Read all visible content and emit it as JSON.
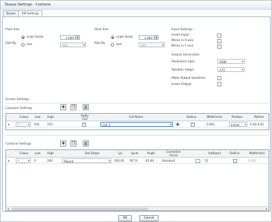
{
  "window": {
    "title": "Queue Settings - Contone"
  },
  "tabs": [
    {
      "label": "Queue"
    },
    {
      "label": "RIP Settings"
    }
  ],
  "pixel_size": {
    "title": "Pixel Size",
    "size_by_label": "Size By",
    "opt_scale_label": "scale factor",
    "opt_mm_label": "mm",
    "scale_value": "1.000",
    "mm_value": "500"
  },
  "slow_size": {
    "title": "Slow Size",
    "size_by_label": "Size By",
    "opt_scale_label": "scale factor",
    "opt_mm_label": "mm",
    "scale_value": "1.000",
    "mm_value": "500"
  },
  "input_settings": {
    "title": "Input Settings",
    "invert_input": "Invert Input",
    "mirror_x": "Mirror in X axis",
    "mirror_y": "Mirror in Y axis"
  },
  "output_generation": {
    "title": "Output Generation",
    "resolution_label": "Resolution (dpi)",
    "resolution_value": "5080",
    "rotation_label": "Rotation (degs)",
    "rotation_value": "270",
    "seamless_label": "Make Output Seamless",
    "invert_output_label": "Invert Output"
  },
  "screen_settings": {
    "title": "Screen Settings"
  },
  "linework": {
    "title": "Linework Settings",
    "columns": [
      "Colour",
      "Low",
      "High",
      "Apply Cell",
      "Cell Name",
      "Outline",
      "Width(mm)",
      "Position",
      "Pattern"
    ],
    "row": {
      "marker": "▸",
      "colour": "*",
      "low": "201",
      "high": "255",
      "cell_name": "cell_1",
      "width": "0.002",
      "position": "Inside",
      "pattern": "0.02,0.02"
    }
  },
  "contone": {
    "title": "Contone Settings",
    "columns": [
      "Colour",
      "Low",
      "High",
      "Dot Shape",
      "Lpi",
      "Lpcm",
      "Angle",
      "Correction Curve",
      "Half(µm)",
      "Outline",
      "Width(mm)"
    ],
    "row": {
      "marker": "▸",
      "colour": "*",
      "low": "0",
      "high": "200",
      "dot_shape": "Round",
      "lpi": "200.00",
      "lpcm": "78.74",
      "angle": "45.00",
      "curve": "Standard",
      "half": "15",
      "width": "0.000"
    }
  },
  "footer": {
    "ok_label": "OK",
    "cancel_label": "Cancel"
  },
  "icons": {
    "add": "plus-icon",
    "copy": "copy-icon",
    "delete": "trash-icon",
    "curve": "curve-icon"
  },
  "colors": {
    "accent": "#1e5db5",
    "border": "#aab4c0"
  }
}
